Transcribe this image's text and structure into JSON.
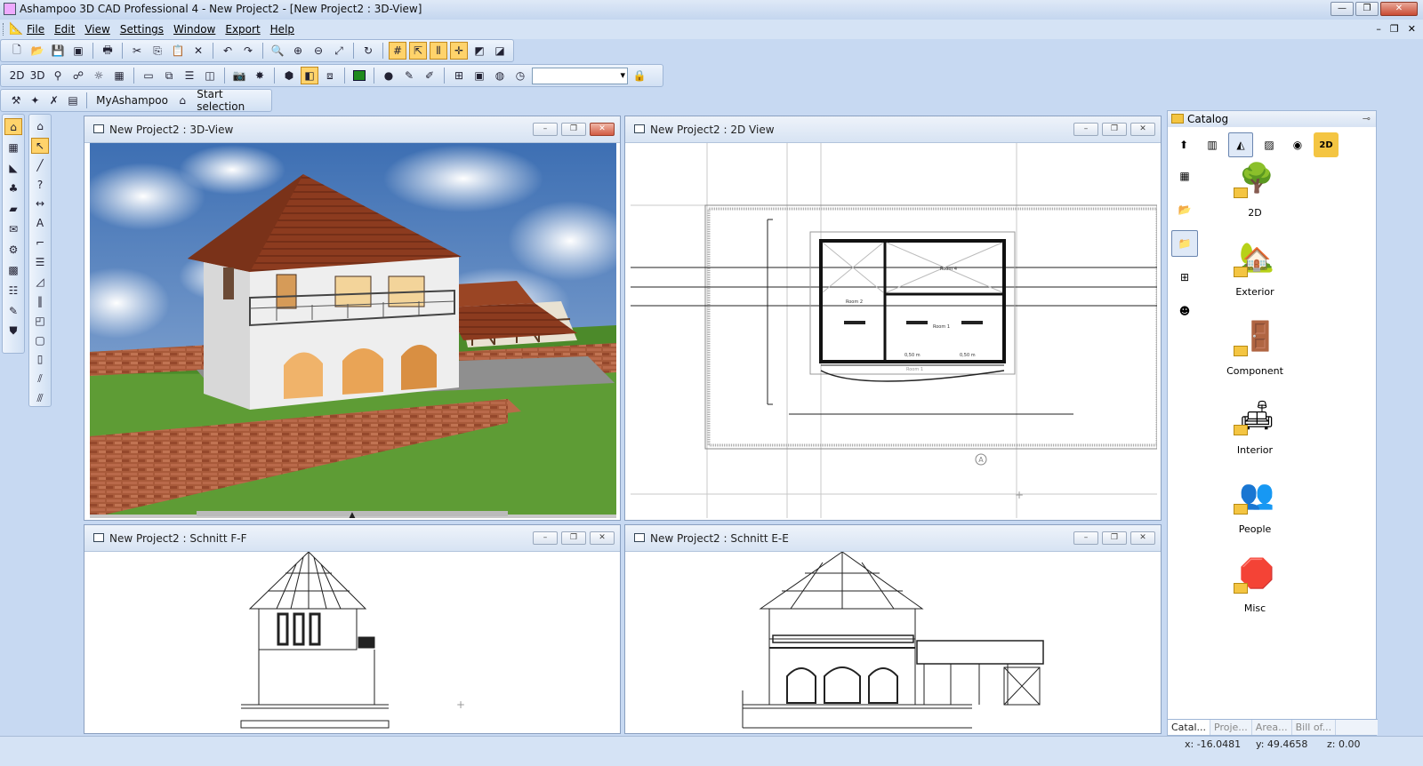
{
  "window": {
    "title": "Ashampoo 3D CAD Professional 4 - New Project2 - [New Project2 : 3D-View]",
    "minimize": "—",
    "maximize": "❐",
    "close": "✕"
  },
  "menu": {
    "items": [
      "File",
      "Edit",
      "View",
      "Settings",
      "Window",
      "Export",
      "Help"
    ],
    "mdi_controls": [
      "–",
      "❐",
      "✕"
    ]
  },
  "toolbar2": {
    "myashampoo": "MyAshampoo",
    "start_selection": "Start selection"
  },
  "toolbar_view_labels": {
    "two_d": "2D",
    "three_d": "3D"
  },
  "windows": {
    "view3d": {
      "title": "New Project2 : 3D-View"
    },
    "view2d": {
      "title": "New Project2 : 2D View"
    },
    "schnitt_ff": {
      "title": "New Project2 : Schnitt F-F"
    },
    "schnitt_ee": {
      "title": "New Project2 : Schnitt E-E"
    },
    "btn_min": "–",
    "btn_max": "❐",
    "btn_close": "✕"
  },
  "plan_labels": {
    "room4": "Room 4",
    "room2": "Room 2",
    "room1": "Room 1",
    "room1b": "Room 1",
    "dim1": "0,50 m",
    "dim2": "0,50 m",
    "north": "A"
  },
  "catalog": {
    "title": "Catalog",
    "items": [
      {
        "label": "2D"
      },
      {
        "label": "Exterior"
      },
      {
        "label": "Component"
      },
      {
        "label": "Interior"
      },
      {
        "label": "People"
      },
      {
        "label": "Misc"
      }
    ],
    "tabs": [
      "Catal...",
      "Proje...",
      "Area...",
      "Bill of..."
    ],
    "icon_2d": "2D"
  },
  "status": {
    "x": "x: -16.0481",
    "y": "y: 49.4658",
    "z": "z: 0.00"
  },
  "colors": {
    "accent": "#ffd36b",
    "frame": "#c7d9f2",
    "brick": "#a85a3a",
    "roof": "#8c3b1f",
    "grass": "#4c8a2a"
  }
}
